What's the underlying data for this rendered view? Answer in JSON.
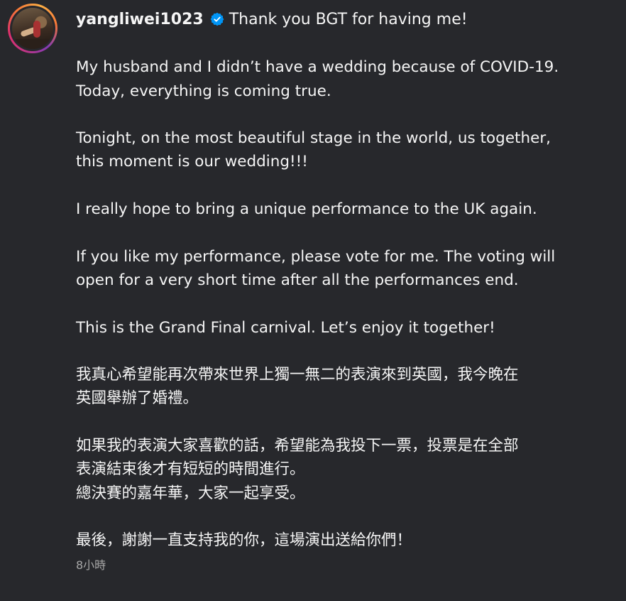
{
  "post": {
    "username": "yangliwei1023",
    "verified_icon": "verified-badge-icon",
    "first_line": "Thank you BGT for having me!",
    "paragraphs": [
      [
        "My husband and I didn’t have a wedding because of COVID-19.",
        "Today, everything is coming true."
      ],
      [
        "Tonight, on the most beautiful stage in the world, us together,",
        "this moment is our wedding!!!"
      ],
      [
        "I really hope to bring a unique performance to the UK again."
      ],
      [
        "If you like my performance, please vote for me. The voting will",
        "open for a very short time after all the performances end."
      ],
      [
        "This is the Grand Final carnival. Let’s enjoy it together!"
      ],
      [
        "我真心希望能再次帶來世界上獨一無二的表演來到英國，我今晚在",
        "英國舉辦了婚禮。"
      ],
      [
        "如果我的表演大家喜歡的話，希望能為我投下一票，投票是在全部",
        "表演結束後才有短短的時間進行。",
        "總決賽的嘉年華，大家一起享受。"
      ],
      [
        "最後，謝謝一直支持我的你，這場演出送給你們！"
      ]
    ],
    "timestamp": "8小時"
  },
  "colors": {
    "background": "#27282c",
    "text": "#f5f5f5",
    "muted": "#a8a8a8",
    "verified": "#0095f6"
  }
}
